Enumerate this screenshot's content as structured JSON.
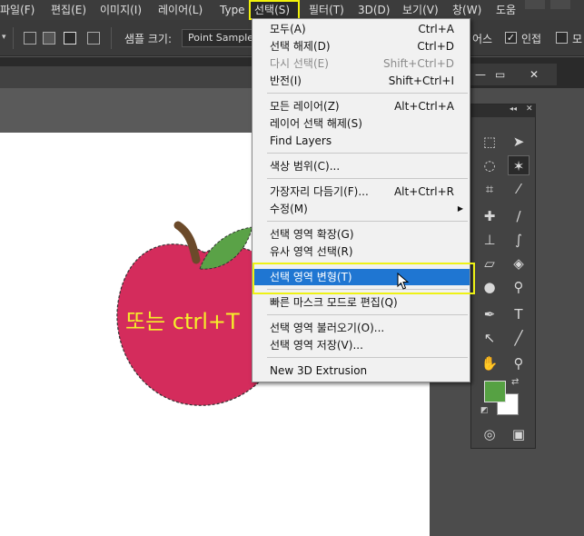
{
  "menubar": {
    "items": [
      "파일(F)",
      "편집(E)",
      "이미지(I)",
      "레이어(L)",
      "Type",
      "선택(S)",
      "필터(T)",
      "3D(D)",
      "보기(V)",
      "창(W)",
      "도움"
    ]
  },
  "options_bar": {
    "sample_size_label": "샘플 크기:",
    "sample_size_value": "Point Sample",
    "anti_alias_partial": "어스",
    "contiguous_label": "인접",
    "contiguous_checked": "✓",
    "all_layers_partial": "모"
  },
  "floating_window": {
    "minimize": "—",
    "restore": "▭",
    "close": "✕"
  },
  "tools_panel": {
    "collapse": "◂◂",
    "close": "✕"
  },
  "canvas": {
    "apple_text": "또는 ctrl+T"
  },
  "colors": {
    "foreground": "#56a143",
    "background": "#ffffff",
    "apple": "#d42c5c",
    "highlight": "#1f76d2",
    "annotation": "#eef215"
  },
  "dropdown": {
    "items": [
      {
        "label": "모두(A)",
        "shortcut": "Ctrl+A"
      },
      {
        "label": "선택 해제(D)",
        "shortcut": "Ctrl+D"
      },
      {
        "label": "다시 선택(E)",
        "shortcut": "Shift+Ctrl+D"
      },
      {
        "label": "반전(I)",
        "shortcut": "Shift+Ctrl+I"
      },
      {
        "label": "모든 레이어(Z)",
        "shortcut": "Alt+Ctrl+A"
      },
      {
        "label": "레이어 선택 해제(S)",
        "shortcut": ""
      },
      {
        "label": "Find Layers",
        "shortcut": ""
      },
      {
        "label": "색상 범위(C)...",
        "shortcut": ""
      },
      {
        "label": "가장자리 다듬기(F)...",
        "shortcut": "Alt+Ctrl+R"
      },
      {
        "label": "수정(M)",
        "shortcut": ""
      },
      {
        "label": "선택 영역 확장(G)",
        "shortcut": ""
      },
      {
        "label": "유사 영역 선택(R)",
        "shortcut": ""
      },
      {
        "label": "선택 영역 변형(T)",
        "shortcut": ""
      },
      {
        "label": "빠른 마스크 모드로 편집(Q)",
        "shortcut": ""
      },
      {
        "label": "선택 영역 불러오기(O)...",
        "shortcut": ""
      },
      {
        "label": "선택 영역 저장(V)...",
        "shortcut": ""
      },
      {
        "label": "New 3D Extrusion",
        "shortcut": ""
      }
    ]
  }
}
